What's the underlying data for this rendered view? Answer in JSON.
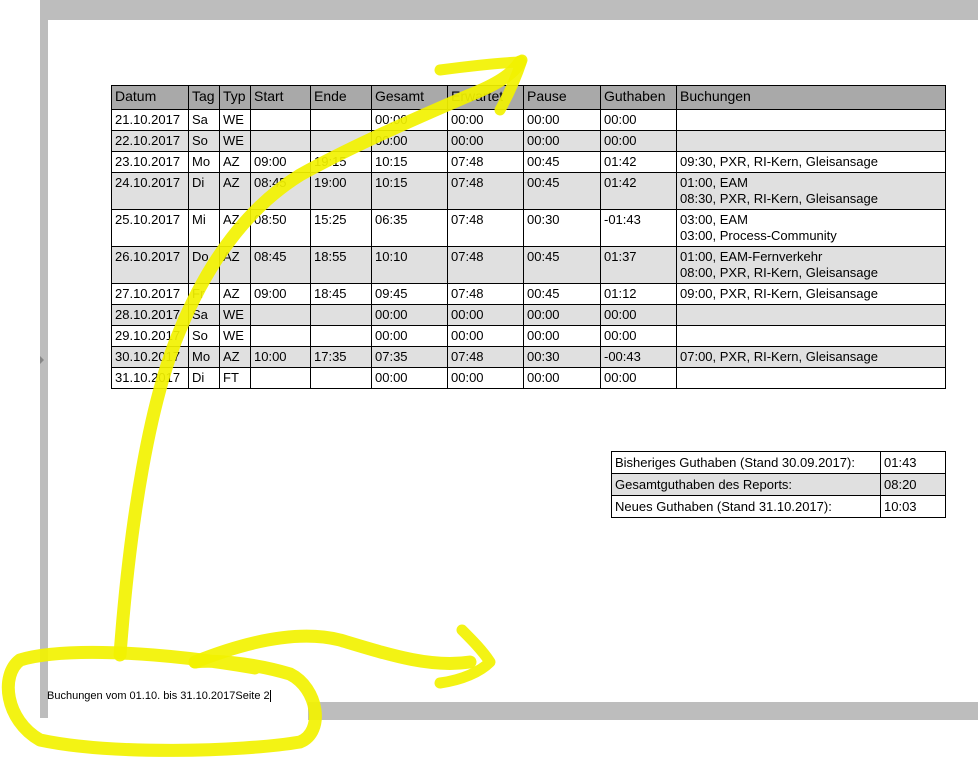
{
  "table": {
    "headers": [
      "Datum",
      "Tag",
      "Typ",
      "Start",
      "Ende",
      "Gesamt",
      "Erwartet",
      "Pause",
      "Guthaben",
      "Buchungen"
    ],
    "rows": [
      {
        "datum": "21.10.2017",
        "tag": "Sa",
        "typ": "WE",
        "start": "",
        "ende": "",
        "gesamt": "00:00",
        "erwartet": "00:00",
        "pause": "00:00",
        "guthaben": "00:00",
        "buchungen": [
          "",
          ""
        ]
      },
      {
        "datum": "22.10.2017",
        "tag": "So",
        "typ": "WE",
        "start": "",
        "ende": "",
        "gesamt": "00:00",
        "erwartet": "00:00",
        "pause": "00:00",
        "guthaben": "00:00",
        "buchungen": [
          "",
          ""
        ]
      },
      {
        "datum": "23.10.2017",
        "tag": "Mo",
        "typ": "AZ",
        "start": "09:00",
        "ende": "19:15",
        "gesamt": "10:15",
        "erwartet": "07:48",
        "pause": "00:45",
        "guthaben": "01:42",
        "buchungen": [
          "09:30, PXR, RI-Kern, Gleisansage",
          ""
        ]
      },
      {
        "datum": "24.10.2017",
        "tag": "Di",
        "typ": "AZ",
        "start": "08:45",
        "ende": "19:00",
        "gesamt": "10:15",
        "erwartet": "07:48",
        "pause": "00:45",
        "guthaben": "01:42",
        "buchungen": [
          "01:00, EAM",
          "08:30, PXR, RI-Kern, Gleisansage"
        ]
      },
      {
        "datum": "25.10.2017",
        "tag": "Mi",
        "typ": "AZ",
        "start": "08:50",
        "ende": "15:25",
        "gesamt": "06:35",
        "erwartet": "07:48",
        "pause": "00:30",
        "guthaben": "-01:43",
        "buchungen": [
          "03:00, EAM",
          "03:00, Process-Community"
        ]
      },
      {
        "datum": "26.10.2017",
        "tag": "Do",
        "typ": "AZ",
        "start": "08:45",
        "ende": "18:55",
        "gesamt": "10:10",
        "erwartet": "07:48",
        "pause": "00:45",
        "guthaben": "01:37",
        "buchungen": [
          "01:00, EAM-Fernverkehr",
          "08:00, PXR, RI-Kern, Gleisansage"
        ]
      },
      {
        "datum": "27.10.2017",
        "tag": "Fr",
        "typ": "AZ",
        "start": "09:00",
        "ende": "18:45",
        "gesamt": "09:45",
        "erwartet": "07:48",
        "pause": "00:45",
        "guthaben": "01:12",
        "buchungen": [
          "09:00, PXR, RI-Kern, Gleisansage",
          ""
        ]
      },
      {
        "datum": "28.10.2017",
        "tag": "Sa",
        "typ": "WE",
        "start": "",
        "ende": "",
        "gesamt": "00:00",
        "erwartet": "00:00",
        "pause": "00:00",
        "guthaben": "00:00",
        "buchungen": [
          "",
          ""
        ]
      },
      {
        "datum": "29.10.2017",
        "tag": "So",
        "typ": "WE",
        "start": "",
        "ende": "",
        "gesamt": "00:00",
        "erwartet": "00:00",
        "pause": "00:00",
        "guthaben": "00:00",
        "buchungen": [
          "",
          ""
        ]
      },
      {
        "datum": "30.10.2017",
        "tag": "Mo",
        "typ": "AZ",
        "start": "10:00",
        "ende": "17:35",
        "gesamt": "07:35",
        "erwartet": "07:48",
        "pause": "00:30",
        "guthaben": "-00:43",
        "buchungen": [
          "07:00, PXR, RI-Kern, Gleisansage",
          ""
        ]
      },
      {
        "datum": "31.10.2017",
        "tag": "Di",
        "typ": "FT",
        "start": "",
        "ende": "",
        "gesamt": "00:00",
        "erwartet": "00:00",
        "pause": "00:00",
        "guthaben": "00:00",
        "buchungen": [
          "",
          ""
        ]
      }
    ]
  },
  "summary": [
    {
      "label": "Bisheriges Guthaben (Stand 30.09.2017):",
      "value": "01:43"
    },
    {
      "label": "Gesamtguthaben des Reports:",
      "value": "08:20"
    },
    {
      "label": "Neues Guthaben (Stand 31.10.2017):",
      "value": "10:03"
    }
  ],
  "footer": {
    "text": "Buchungen vom 01.10. bis 31.10.2017",
    "page": "Seite 2"
  },
  "colors": {
    "header_bg": "#a9a9a9",
    "alt_row_bg": "#e0e0e0",
    "highlighter": "#f2f200"
  }
}
